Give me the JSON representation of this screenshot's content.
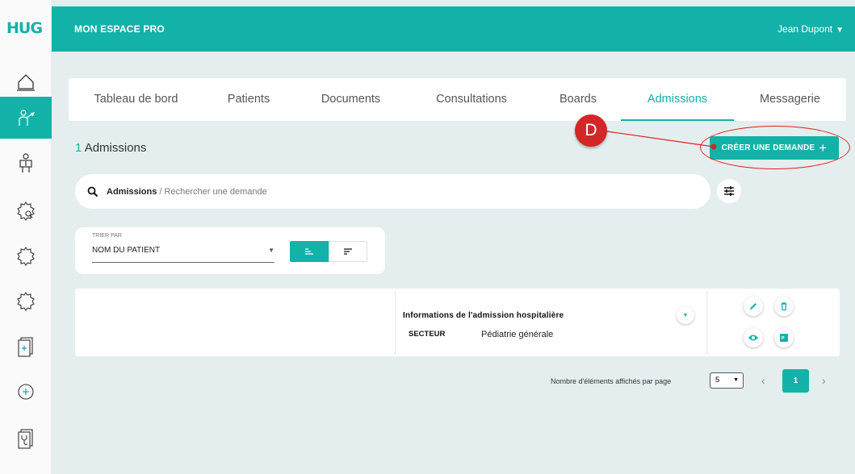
{
  "logo": "HUG",
  "header": {
    "brand": "MON ESPACE PRO",
    "user": "Jean Dupont"
  },
  "tabs": [
    {
      "label": "Tableau de bord"
    },
    {
      "label": "Patients"
    },
    {
      "label": "Documents"
    },
    {
      "label": "Consultations"
    },
    {
      "label": "Boards"
    },
    {
      "label": "Admissions",
      "active": true
    },
    {
      "label": "Messagerie"
    }
  ],
  "summary": {
    "count": "1",
    "label": "Admissions"
  },
  "create_button": {
    "label": "CRÉER UNE DEMANDE",
    "icon": "plus-icon"
  },
  "annotation": {
    "marker": "D"
  },
  "search": {
    "scope": "Admissions",
    "separator": " / ",
    "placeholder": "Rechercher une demande"
  },
  "sort": {
    "label": "TRIER PAR",
    "value": "NOM DU PATIENT"
  },
  "admission": {
    "title": "Informations de l'admission hospitalière",
    "field_label": "SECTEUR",
    "field_value": "Pédiatrie générale"
  },
  "pagination": {
    "label": "Nombre d'éléments affichés par page",
    "page_size": "5",
    "current_page": "1",
    "prev": "‹",
    "next": "›"
  },
  "sidebar": {
    "items": [
      {
        "icon": "home-icon"
      },
      {
        "icon": "doctor-icon",
        "active": true
      },
      {
        "icon": "patient-icon"
      },
      {
        "icon": "gear-search-icon"
      },
      {
        "icon": "gear-icon"
      },
      {
        "icon": "gear-outline-icon"
      },
      {
        "icon": "document-add-icon"
      },
      {
        "icon": "add-circle-icon"
      },
      {
        "icon": "stethoscope-doc-icon"
      }
    ]
  },
  "colors": {
    "accent": "#13b2a8",
    "annotation": "#d32626",
    "background": "#e4eeee"
  }
}
